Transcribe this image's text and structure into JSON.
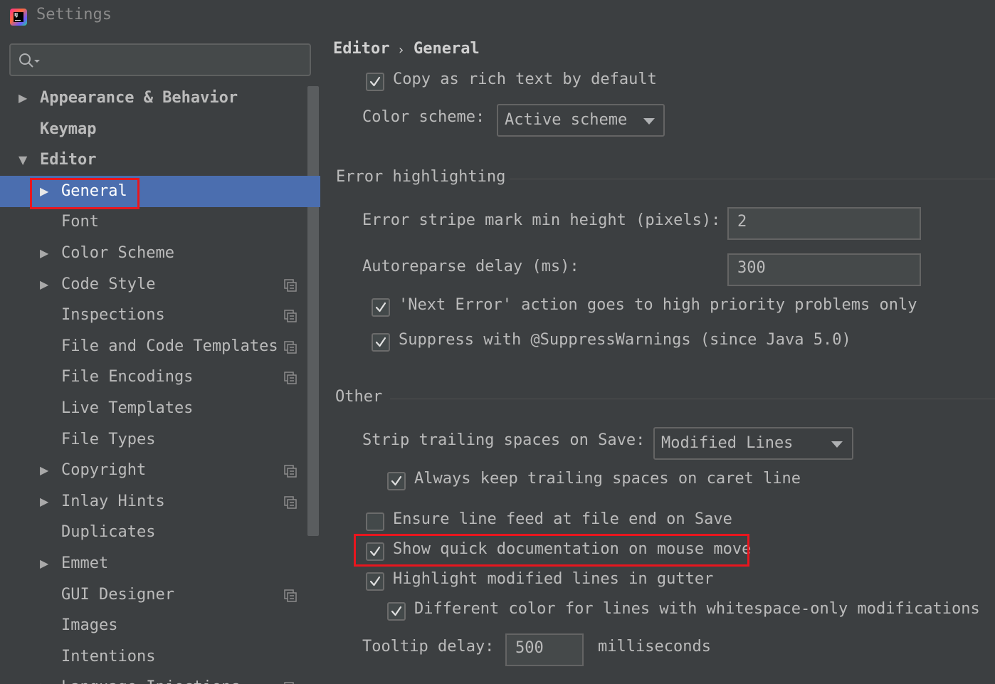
{
  "window": {
    "title": "Settings",
    "logo_text": "IJ"
  },
  "search": {
    "placeholder": ""
  },
  "tree": [
    {
      "label": "Appearance & Behavior",
      "bold": true,
      "expander": "right"
    },
    {
      "label": "Keymap",
      "bold": true,
      "expander": ""
    },
    {
      "label": "Editor",
      "bold": true,
      "expander": "down"
    },
    {
      "label": "General",
      "selected": true,
      "expander": "right"
    },
    {
      "label": "Font",
      "expander": ""
    },
    {
      "label": "Color Scheme",
      "expander": "right"
    },
    {
      "label": "Code Style",
      "expander": "right",
      "project_icon": true
    },
    {
      "label": "Inspections",
      "expander": "",
      "project_icon": true
    },
    {
      "label": "File and Code Templates",
      "expander": "",
      "project_icon": true
    },
    {
      "label": "File Encodings",
      "expander": "",
      "project_icon": true
    },
    {
      "label": "Live Templates",
      "expander": ""
    },
    {
      "label": "File Types",
      "expander": ""
    },
    {
      "label": "Copyright",
      "expander": "right",
      "project_icon": true
    },
    {
      "label": "Inlay Hints",
      "expander": "right",
      "project_icon": true
    },
    {
      "label": "Duplicates",
      "expander": ""
    },
    {
      "label": "Emmet",
      "expander": "right"
    },
    {
      "label": "GUI Designer",
      "expander": "",
      "project_icon": true
    },
    {
      "label": "Images",
      "expander": ""
    },
    {
      "label": "Intentions",
      "expander": ""
    },
    {
      "label": "Language Injections",
      "expander": "right",
      "project_icon": true
    }
  ],
  "breadcrumb": {
    "parent": "Editor",
    "separator": "›",
    "current": "General"
  },
  "settings": {
    "copy_rich_text": {
      "label": "Copy as rich text by default",
      "checked": true
    },
    "color_scheme": {
      "label": "Color scheme:",
      "value": "Active scheme"
    },
    "error_section": "Error highlighting",
    "error_stripe": {
      "label": "Error stripe mark min height (pixels):",
      "value": "2"
    },
    "autoreparse": {
      "label": "Autoreparse delay (ms):",
      "value": "300"
    },
    "next_error": {
      "label": "'Next Error' action goes to high priority problems only",
      "checked": true
    },
    "suppress": {
      "label": "Suppress with @SuppressWarnings (since Java 5.0)",
      "checked": true
    },
    "other_section": "Other",
    "strip_trailing": {
      "label": "Strip trailing spaces on Save:",
      "value": "Modified Lines"
    },
    "keep_trailing": {
      "label": "Always keep trailing spaces on caret line",
      "checked": true
    },
    "ensure_lf": {
      "label": "Ensure line feed at file end on Save",
      "checked": false
    },
    "quick_doc": {
      "label": "Show quick documentation on mouse move",
      "checked": true
    },
    "highlight_modified": {
      "label": "Highlight modified lines in gutter",
      "checked": true
    },
    "different_color": {
      "label": "Different color for lines with whitespace-only modifications",
      "checked": true
    },
    "tooltip": {
      "label": "Tooltip delay:",
      "value": "500",
      "unit": "milliseconds"
    }
  },
  "colors": {
    "selection": "#4b6eaf",
    "highlight_box": "#e8161e",
    "background": "#3c3f41"
  }
}
